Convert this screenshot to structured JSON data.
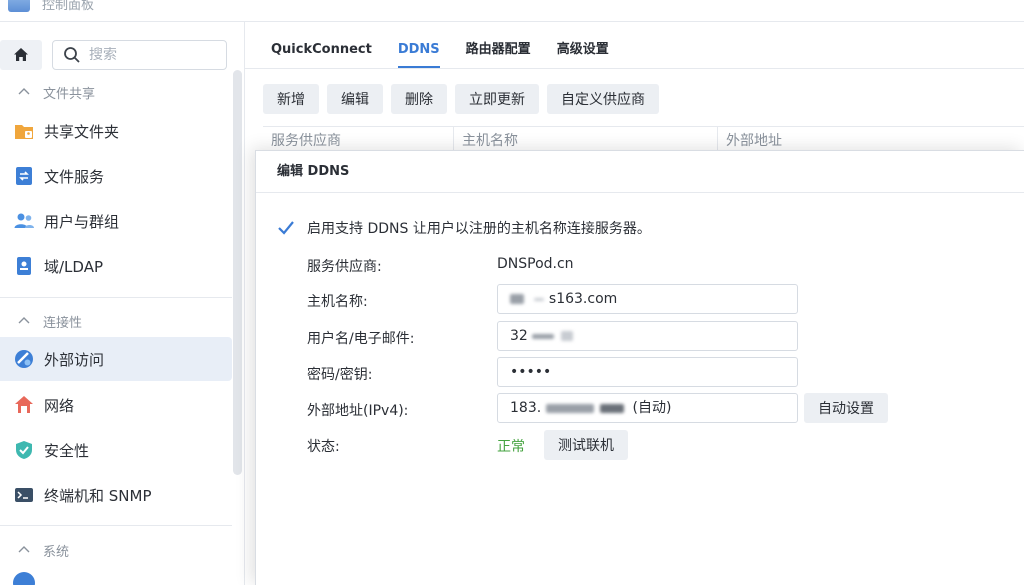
{
  "window": {
    "title": "控制面板"
  },
  "sidebar": {
    "search_placeholder": "搜索",
    "sections": [
      {
        "label": "文件共享"
      },
      {
        "label": "连接性"
      },
      {
        "label": "系统"
      }
    ],
    "items": [
      {
        "label": "共享文件夹",
        "icon": "shared-folder-icon"
      },
      {
        "label": "文件服务",
        "icon": "file-service-icon"
      },
      {
        "label": "用户与群组",
        "icon": "users-icon"
      },
      {
        "label": "域/LDAP",
        "icon": "ldap-icon"
      },
      {
        "label": "外部访问",
        "icon": "external-access-icon",
        "active": true
      },
      {
        "label": "网络",
        "icon": "network-icon"
      },
      {
        "label": "安全性",
        "icon": "security-shield-icon"
      },
      {
        "label": "终端机和 SNMP",
        "icon": "terminal-icon"
      }
    ]
  },
  "main": {
    "tabs": [
      {
        "label": "QuickConnect"
      },
      {
        "label": "DDNS",
        "active": true
      },
      {
        "label": "路由器配置"
      },
      {
        "label": "高级设置"
      }
    ],
    "toolbar": [
      "新增",
      "编辑",
      "删除",
      "立即更新",
      "自定义供应商"
    ],
    "table_headers": [
      "服务供应商",
      "主机名称",
      "外部地址"
    ]
  },
  "dialog": {
    "title": "编辑 DDNS",
    "enable_checkbox_label": "启用支持 DDNS 让用户以注册的主机名称连接服务器。",
    "enable_checked": true,
    "labels": {
      "provider": "服务供应商:",
      "hostname": "主机名称:",
      "username": "用户名/电子邮件:",
      "password": "密码/密钥:",
      "external_ip": "外部地址(IPv4):",
      "status": "状态:"
    },
    "values": {
      "provider": "DNSPod.cn",
      "hostname_suffix": "s163.com",
      "username_prefix": "32",
      "password_dots": "•••••",
      "external_ip_prefix": "183.",
      "external_ip_suffix": "(自动)",
      "status": "正常"
    },
    "buttons": {
      "auto_setup": "自动设置",
      "test_connection": "测试联机"
    }
  },
  "colors": {
    "accent": "#3a7bd5",
    "status_ok": "#45a340"
  }
}
